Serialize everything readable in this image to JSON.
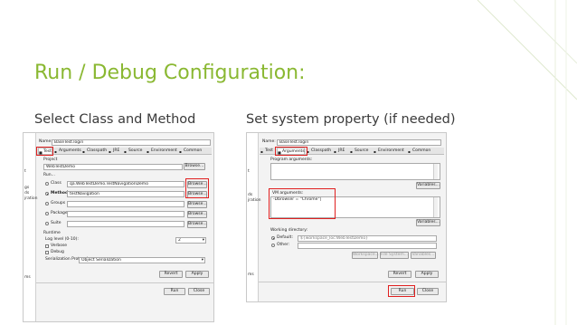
{
  "slide": {
    "title": "Run / Debug Configuration:",
    "subtitle_left": "Select Class and Method",
    "subtitle_right": "Set system property (if needed)"
  },
  "colors": {
    "title": "#8ab832",
    "highlight": "#e02020"
  },
  "left": {
    "side_labels": [
      "t",
      "gs",
      "ds",
      "jration",
      "ms"
    ],
    "name_label": "Name:",
    "name_value": "BaseTest.login",
    "tabs": [
      "Test",
      "Arguments",
      "Classpath",
      "JRE",
      "Source",
      "Environment",
      "Common"
    ],
    "project_label": "Project",
    "project_value": "WebTestDemo",
    "project_browse": "Browse...",
    "run_label": "Run...",
    "class_label": "Class",
    "class_value": "qa.WebTestDemo.TestNavigationDemo",
    "class_browse": "Browse...",
    "method_label": "Method",
    "method_value": "testNavigation",
    "method_browse": "Browse...",
    "groups_label": "Groups",
    "groups_browse": "Browse...",
    "package_label": "Package",
    "package_browse": "Browse...",
    "suite_label": "Suite",
    "suite_browse": "Browse...",
    "runtime_label": "Runtime",
    "log_level_label": "Log level (0-10):",
    "log_level_value": "2",
    "verbose_label": "Verbose",
    "debug_label": "Debug",
    "serialization_label": "Serialization Protocol:",
    "serialization_value": "Object Serialization",
    "revert": "Revert",
    "apply": "Apply",
    "run": "Run",
    "close": "Close"
  },
  "right": {
    "side_labels": [
      "t",
      "ds",
      "jration",
      "ms"
    ],
    "name_label": "Name:",
    "name_value": "BaseTest.login",
    "tabs": [
      "Test",
      "Arguments",
      "Classpath",
      "JRE",
      "Source",
      "Environment",
      "Common"
    ],
    "program_args_label": "Program arguments:",
    "variables": "Variables...",
    "vm_args_label": "VM arguments:",
    "vm_args_value": "-Dbrowser = \"Chrome\"|",
    "variables2": "Variables...",
    "working_dir_label": "Working directory:",
    "default_label": "Default:",
    "default_value": "${workspace_loc:WebTestDemo}",
    "other_label": "Other:",
    "workspace": "Workspace...",
    "file_system": "File System...",
    "variables3": "Variables...",
    "revert": "Revert",
    "apply": "Apply",
    "run": "Run",
    "close": "Close"
  }
}
